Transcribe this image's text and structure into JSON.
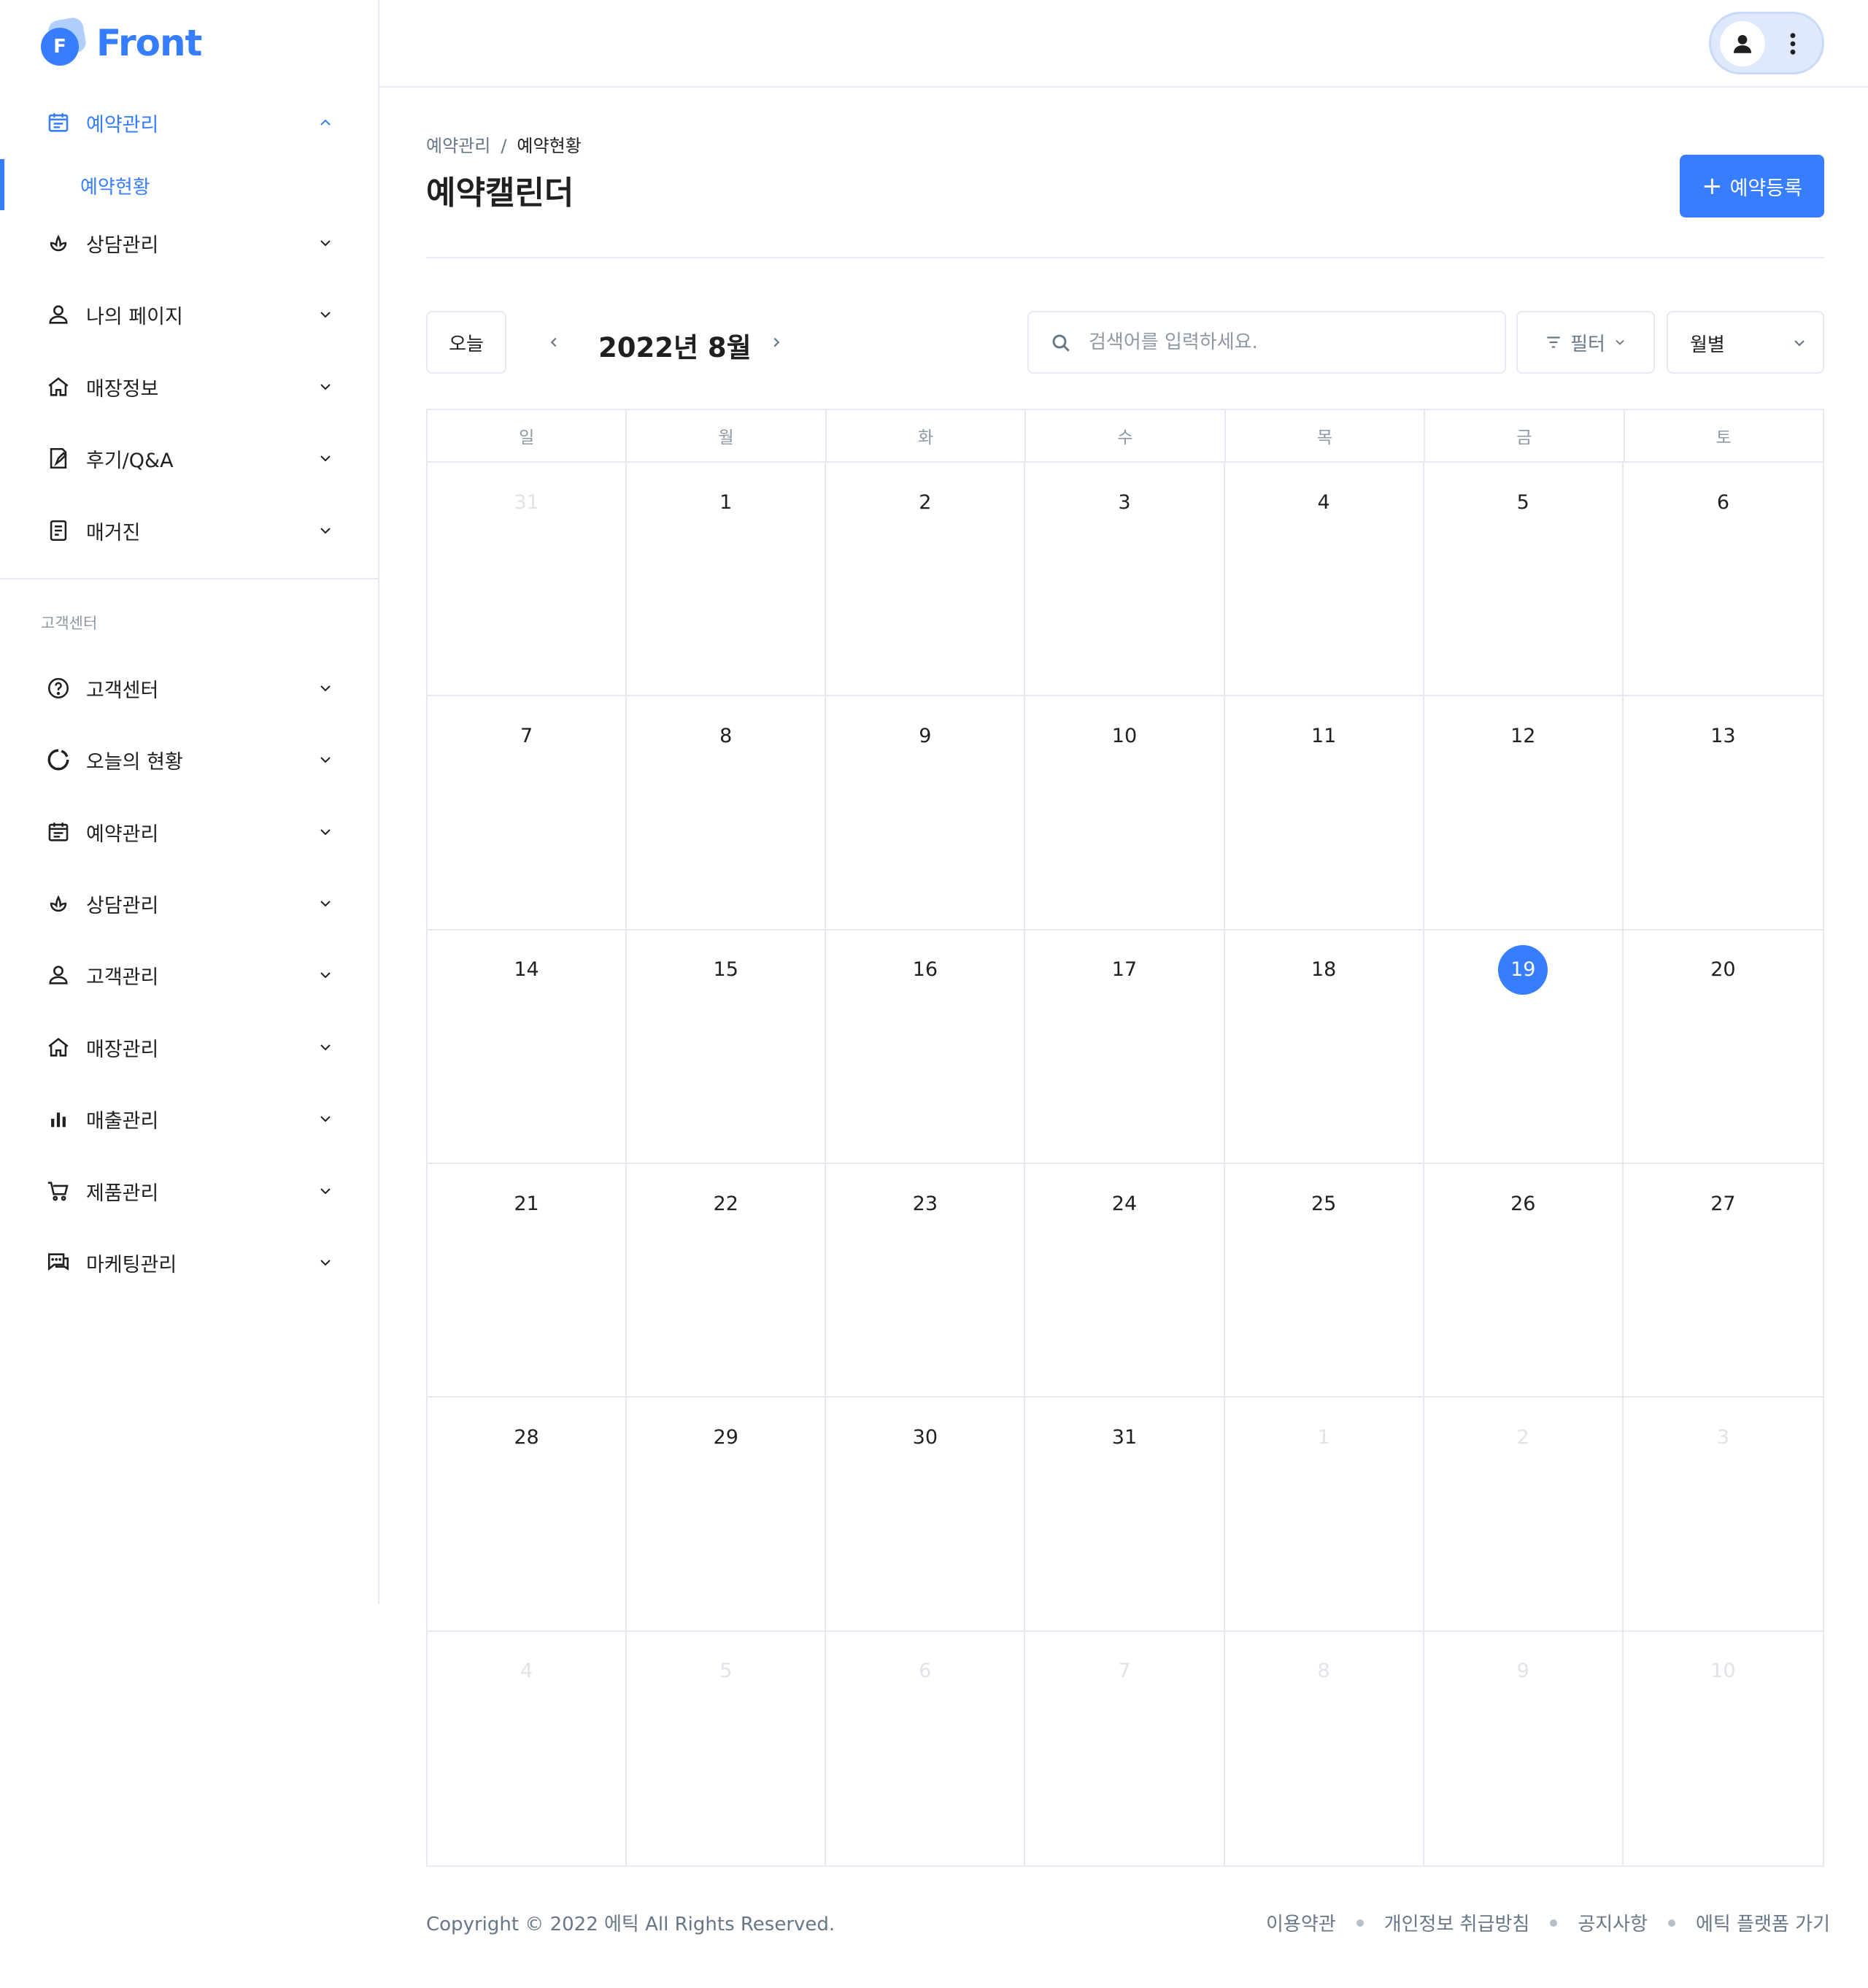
{
  "brand": {
    "name": "Front",
    "mark_letter": "F",
    "accent": "#377dff"
  },
  "sidebar": {
    "items": [
      {
        "label": "예약관리",
        "icon": "calendar-icon",
        "active": true,
        "expanded": true
      },
      {
        "label": "상담관리",
        "icon": "lotus-icon"
      },
      {
        "label": "나의 페이지",
        "icon": "person-icon"
      },
      {
        "label": "매장정보",
        "icon": "home-icon"
      },
      {
        "label": "후기/Q&A",
        "icon": "review-icon"
      },
      {
        "label": "매거진",
        "icon": "book-icon"
      }
    ],
    "sub_item": {
      "label": "예약현황",
      "active": true
    },
    "section_title": "고객센터",
    "section_items": [
      {
        "label": "고객센터",
        "icon": "help-icon"
      },
      {
        "label": "오늘의 현황",
        "icon": "progress-icon"
      },
      {
        "label": "예약관리",
        "icon": "calendar-icon"
      },
      {
        "label": "상담관리",
        "icon": "lotus-icon"
      },
      {
        "label": "고객관리",
        "icon": "person-icon"
      },
      {
        "label": "매장관리",
        "icon": "home-icon"
      },
      {
        "label": "매출관리",
        "icon": "bar-chart-icon"
      },
      {
        "label": "제품관리",
        "icon": "cart-icon"
      },
      {
        "label": "마케팅관리",
        "icon": "chat-icon"
      }
    ]
  },
  "header": {
    "avatar_icon": "user-icon",
    "menu_icon": "kebab-icon"
  },
  "breadcrumb": {
    "parent": "예약관리",
    "separator": "/",
    "current": "예약현황"
  },
  "page_title": "예약캘린더",
  "primary_button": {
    "plus": "+",
    "label": "예약등록"
  },
  "toolbar": {
    "today_label": "오늘",
    "month_label": "2022년 8월",
    "search_placeholder": "검색어를 입력하세요.",
    "filter_label": "필터",
    "view_select_value": "월별"
  },
  "calendar": {
    "weekdays": [
      "일",
      "월",
      "화",
      "수",
      "목",
      "금",
      "토"
    ],
    "days": [
      {
        "n": "31",
        "muted": true
      },
      {
        "n": "1"
      },
      {
        "n": "2"
      },
      {
        "n": "3"
      },
      {
        "n": "4"
      },
      {
        "n": "5"
      },
      {
        "n": "6"
      },
      {
        "n": "7"
      },
      {
        "n": "8"
      },
      {
        "n": "9"
      },
      {
        "n": "10"
      },
      {
        "n": "11"
      },
      {
        "n": "12"
      },
      {
        "n": "13"
      },
      {
        "n": "14"
      },
      {
        "n": "15"
      },
      {
        "n": "16"
      },
      {
        "n": "17"
      },
      {
        "n": "18"
      },
      {
        "n": "19",
        "today": true
      },
      {
        "n": "20"
      },
      {
        "n": "21"
      },
      {
        "n": "22"
      },
      {
        "n": "23"
      },
      {
        "n": "24"
      },
      {
        "n": "25"
      },
      {
        "n": "26"
      },
      {
        "n": "27"
      },
      {
        "n": "28"
      },
      {
        "n": "29"
      },
      {
        "n": "30"
      },
      {
        "n": "31"
      },
      {
        "n": "1",
        "muted": true
      },
      {
        "n": "2",
        "muted": true
      },
      {
        "n": "3",
        "muted": true
      },
      {
        "n": "4",
        "muted": true
      },
      {
        "n": "5",
        "muted": true
      },
      {
        "n": "6",
        "muted": true
      },
      {
        "n": "7",
        "muted": true
      },
      {
        "n": "8",
        "muted": true
      },
      {
        "n": "9",
        "muted": true
      },
      {
        "n": "10",
        "muted": true
      }
    ]
  },
  "footer": {
    "copyright": "Copyright © 2022 에틱 All Rights Reserved.",
    "links": [
      "이용약관",
      "개인정보 취급방침",
      "공지사항",
      "에틱 플랫폼 가기"
    ]
  }
}
